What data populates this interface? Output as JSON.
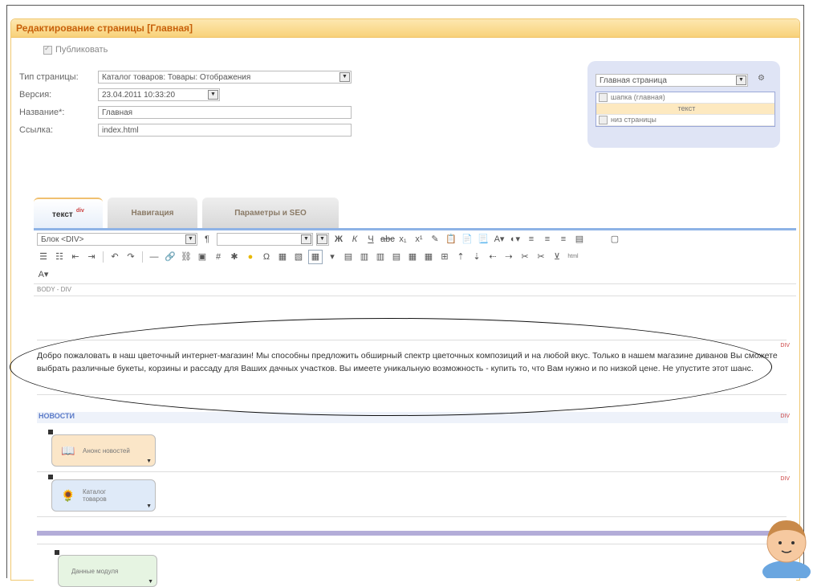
{
  "panel": {
    "title": "Редактирование страницы [Главная]"
  },
  "form": {
    "publish_label": "Публиковать",
    "page_type_label": "Тип страницы:",
    "page_type_value": "Каталог товаров: Товары: Отображения",
    "version_label": "Версия:",
    "version_value": "23.04.2011 10:33:20",
    "name_label": "Название*:",
    "name_value": "Главная",
    "link_label": "Ссылка:",
    "link_value": "index.html"
  },
  "side": {
    "select_value": "Главная страница",
    "items": [
      "шапка (главная)",
      "текст",
      "низ страницы"
    ]
  },
  "tabs": [
    "текст",
    "Навигация",
    "Параметры и SEO"
  ],
  "editor": {
    "format_select": "Блок <DIV>",
    "path": "BODY - DIV",
    "text": "Добро пожаловать в наш цветочный интернет-магазин! Мы способны предложить обширный спектр цветочных композиций и на любой вкус. Только в нашем магазине диванов Вы сможете выбрать различные букеты, корзины и рассаду для Ваших дачных участков. Вы имеете уникальную возможность - купить то, что Вам нужно и по низкой цене. Не упустите этот шанс.",
    "news_label": "НОВОСТИ",
    "div_tag": "DIV",
    "modules": [
      "Анонс новостей",
      "Каталог товаров",
      "Данные модуля"
    ]
  },
  "colors": {
    "accent": "#c7600a",
    "header_bg": "#f8d27a",
    "side_bg": "#dfe4f5",
    "editor_border": "#8eb3e6"
  }
}
